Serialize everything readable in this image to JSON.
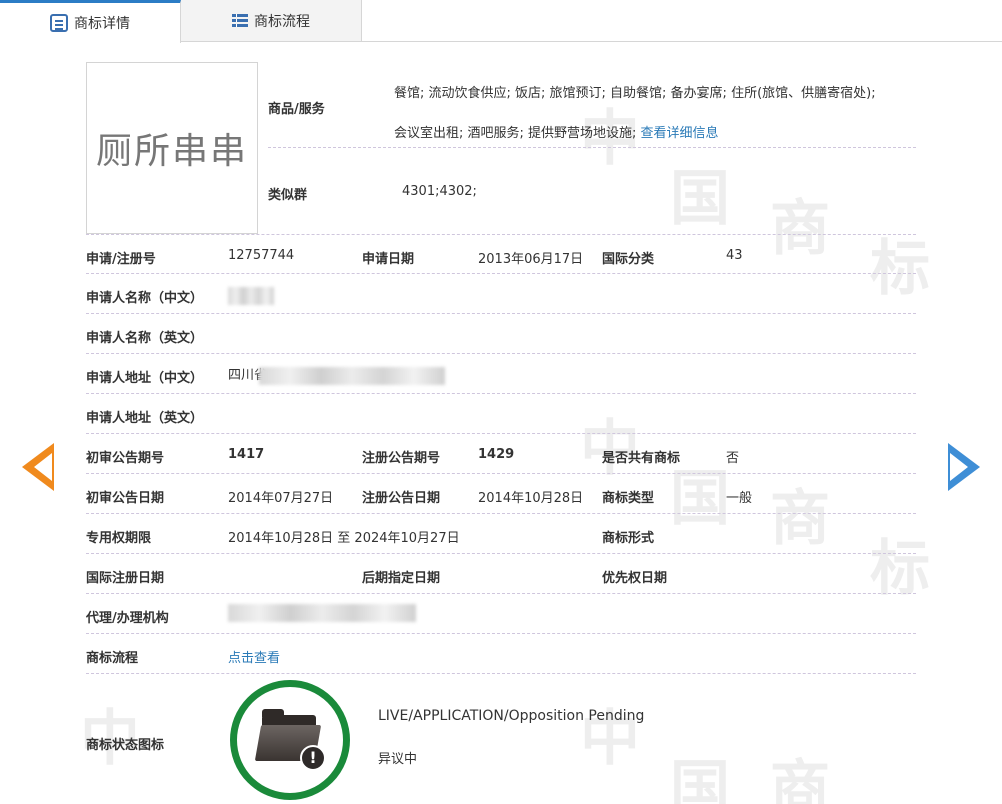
{
  "tabs": {
    "detail": "商标详情",
    "flow": "商标流程"
  },
  "trademark": {
    "logo_text": "厕所串串"
  },
  "goods": {
    "label": "商品/服务",
    "line1": "餐馆; 流动饮食供应; 饭店; 旅馆预订; 自助餐馆; 备办宴席; 住所(旅馆、供膳寄宿处);",
    "line2_text": "会议室出租; 酒吧服务; 提供野营场地设施; ",
    "detail_link": "查看详细信息"
  },
  "similar": {
    "label": "类似群",
    "value": "4301;4302;"
  },
  "rows": {
    "reg_no_label": "申请/注册号",
    "reg_no": "12757744",
    "apply_date_label": "申请日期",
    "apply_date": "2013年06月17日",
    "intl_class_label": "国际分类",
    "intl_class": "43",
    "applicant_cn_label": "申请人名称（中文）",
    "applicant_en_label": "申请人名称（英文）",
    "address_cn_label": "申请人地址（中文）",
    "address_cn_prefix": "四川省",
    "address_en_label": "申请人地址（英文）",
    "prelim_no_label": "初审公告期号",
    "prelim_no": "1417",
    "reg_notice_no_label": "注册公告期号",
    "reg_notice_no": "1429",
    "shared_label": "是否共有商标",
    "shared": "否",
    "prelim_date_label": "初审公告日期",
    "prelim_date": "2014年07月27日",
    "reg_notice_date_label": "注册公告日期",
    "reg_notice_date": "2014年10月28日",
    "type_label": "商标类型",
    "type": "一般",
    "term_label": "专用权期限",
    "term": "2014年10月28日 至 2024年10月27日",
    "form_label": "商标形式",
    "intl_reg_date_label": "国际注册日期",
    "later_date_label": "后期指定日期",
    "priority_date_label": "优先权日期",
    "agency_label": "代理/办理机构",
    "flow_label": "商标流程",
    "flow_link": "点击查看"
  },
  "status": {
    "label": "商标状态图标",
    "en": "LIVE/APPLICATION/Opposition Pending",
    "cn": "异议中",
    "icon": "folder-alert-icon",
    "ring_color": "#1a8a3a"
  },
  "colors": {
    "accent": "#2b7cc5",
    "link": "#2a7ab7",
    "prev_arrow": "#f08a1d",
    "next_arrow": "#3e8ed6"
  }
}
